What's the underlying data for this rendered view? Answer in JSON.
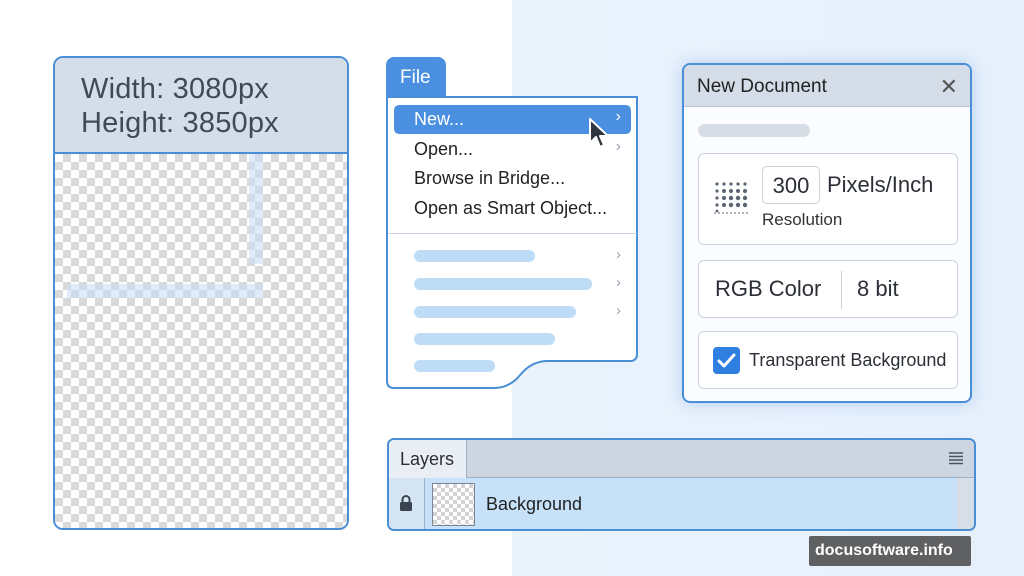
{
  "canvas": {
    "width_label": "Width: 3080px",
    "height_label": "Height: 3850px"
  },
  "file_menu": {
    "tab_label": "File",
    "items": [
      {
        "label": "New...",
        "highlighted": true,
        "has_submenu": true
      },
      {
        "label": "Open...",
        "highlighted": false,
        "has_submenu": true
      },
      {
        "label": "Browse in Bridge...",
        "highlighted": false,
        "has_submenu": false
      },
      {
        "label": "Open as Smart Object...",
        "highlighted": false,
        "has_submenu": false
      }
    ]
  },
  "new_document": {
    "title": "New Document",
    "close_glyph": "✕",
    "resolution_value": "300",
    "resolution_unit": "Pixels/Inch",
    "resolution_label": "Resolution",
    "color_mode": "RGB Color",
    "bit_depth": "8 bit",
    "transparent_background_label": "Transparent Background",
    "transparent_background_checked": true
  },
  "layers": {
    "tab_label": "Layers",
    "rows": [
      {
        "name": "Background",
        "locked": true,
        "selected": true
      }
    ]
  },
  "watermark": "docusoftware.info",
  "colors": {
    "accent": "#4a8fe0",
    "panel_header": "#d4dde8",
    "selection": "#c7e1f8",
    "border": "#4a8fd6"
  },
  "icons": [
    "chevron-right-icon",
    "mouse-cursor-icon",
    "close-icon",
    "resolution-grid-icon",
    "checkmark-icon",
    "lock-icon",
    "panel-menu-icon"
  ]
}
